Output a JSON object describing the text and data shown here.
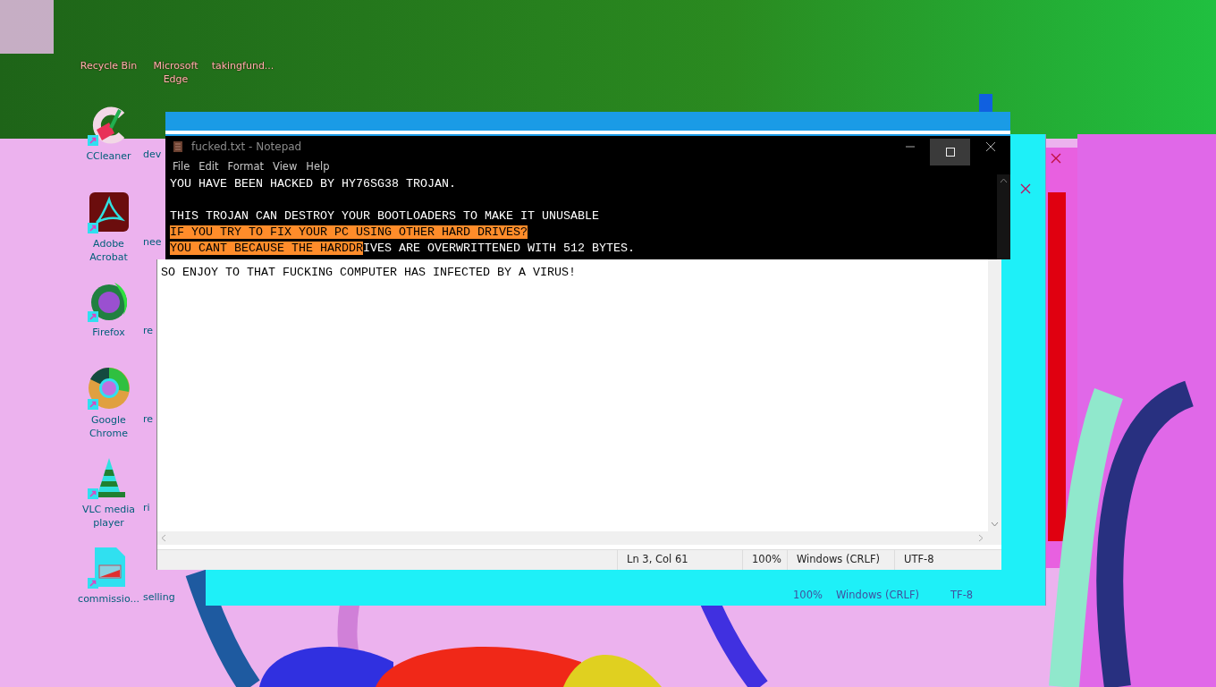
{
  "desktop_icons": [
    {
      "kind": "plain",
      "label": "Recycle Bin"
    },
    {
      "kind": "plain",
      "label": "Microsoft Edge"
    },
    {
      "kind": "plain",
      "label": "takingfund..."
    },
    {
      "kind": "ccleaner",
      "label": "CCleaner"
    },
    {
      "kind": "acrobat",
      "label": "Adobe Acrobat"
    },
    {
      "kind": "firefox",
      "label": "Firefox"
    },
    {
      "kind": "chrome",
      "label": "Google Chrome"
    },
    {
      "kind": "vlc",
      "label": "VLC media player"
    },
    {
      "kind": "document",
      "label": "commissio..."
    },
    {
      "kind": "partial",
      "label": "dev"
    },
    {
      "kind": "partial",
      "label": "nee"
    },
    {
      "kind": "partial",
      "label": "re"
    },
    {
      "kind": "partial",
      "label": "re"
    },
    {
      "kind": "partial",
      "label": "ri"
    },
    {
      "kind": "partial",
      "label": "selling"
    }
  ],
  "notepad": {
    "title": "fucked.txt - Notepad",
    "menu": [
      "File",
      "Edit",
      "Format",
      "View",
      "Help"
    ],
    "lines": [
      {
        "kind": "dark",
        "segments": [
          {
            "text": "YOU HAVE BEEN HACKED BY HY76SG38 TROJAN.",
            "selected": false
          }
        ]
      },
      {
        "kind": "blank"
      },
      {
        "kind": "dark",
        "segments": [
          {
            "text": "THIS TROJAN CAN DESTROY YOUR BOOTLOADERS TO MAKE IT UNUSABLE",
            "selected": false
          }
        ]
      },
      {
        "kind": "dark",
        "segments": [
          {
            "text": "IF YOU TRY TO FIX YOUR PC USING OTHER HARD DRIVES?",
            "selected": true
          }
        ]
      },
      {
        "kind": "dark",
        "segments": [
          {
            "text": "YOU CANT BECAUSE THE HARDDR",
            "selected": true
          },
          {
            "text": "IVES ARE OVERWRITTENED WITH 512 BYTES.",
            "selected": false
          }
        ]
      },
      {
        "kind": "light",
        "segments": [
          {
            "text": "SO ENJOY TO THAT FUCKING COMPUTER HAS INFECTED BY A VIRUS!",
            "selected": false
          }
        ]
      }
    ],
    "status": [
      "Ln 3, Col 61",
      "100%",
      "Windows (CRLF)",
      "UTF-8"
    ]
  },
  "ghost_window": {
    "status": [
      "100%",
      "Windows (CRLF)",
      "TF-8"
    ]
  }
}
